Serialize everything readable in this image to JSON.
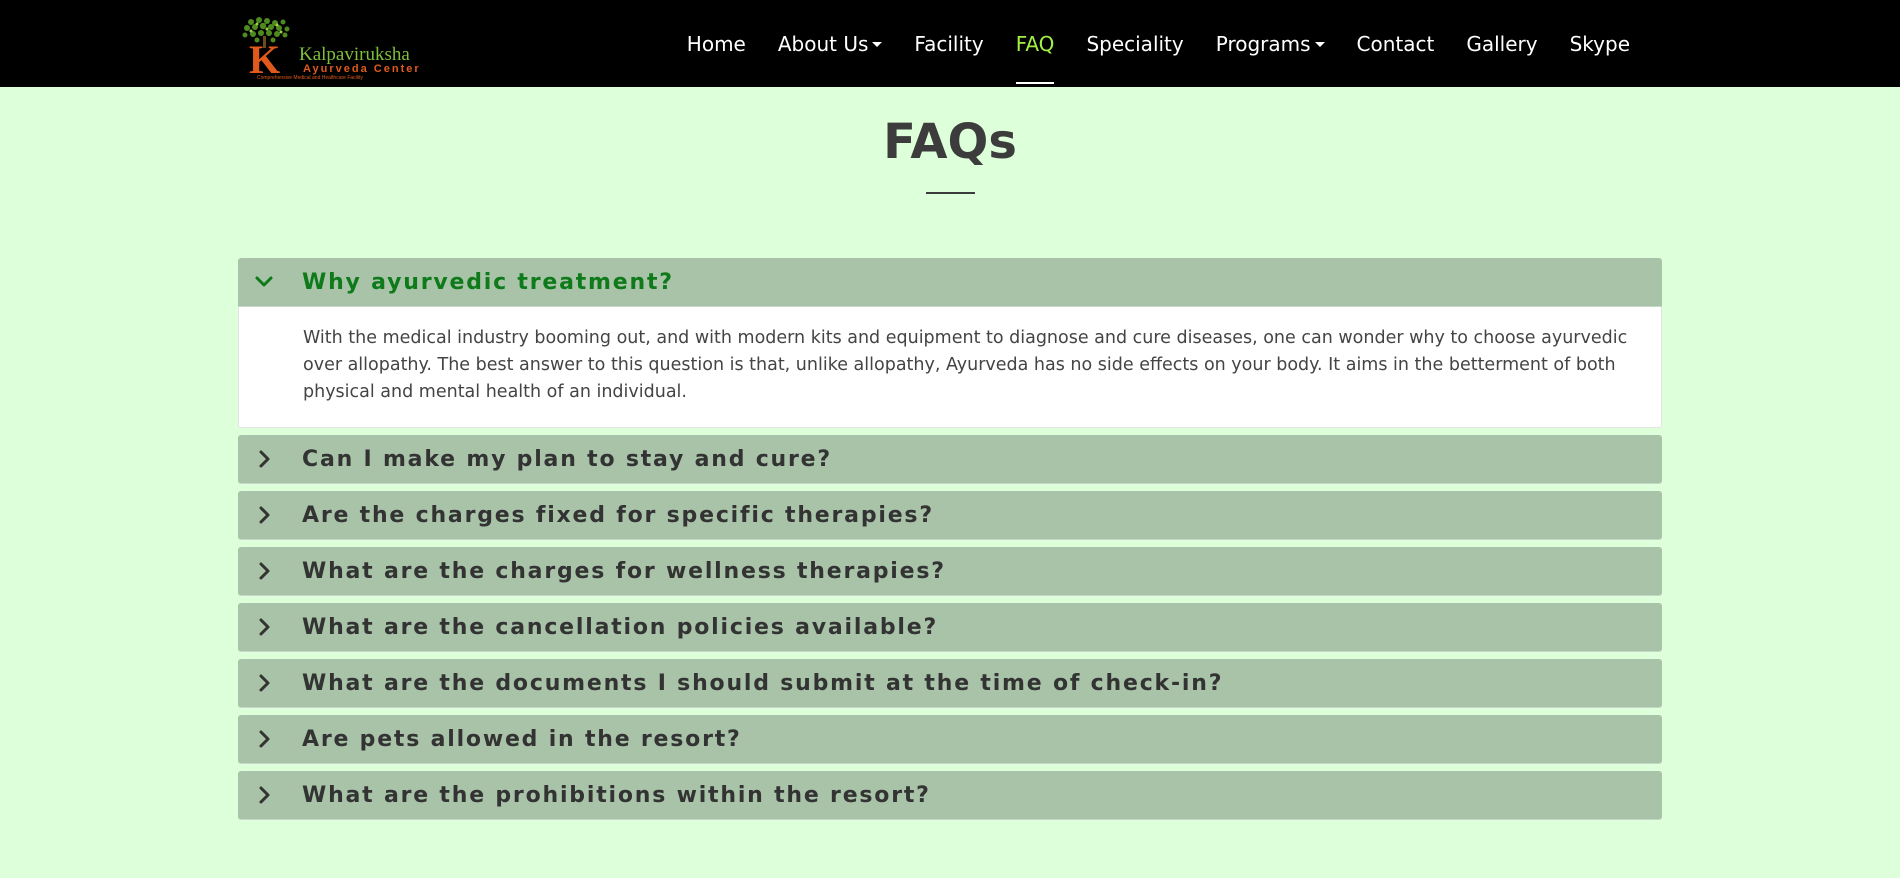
{
  "brand": {
    "logo_letter": "K",
    "logo_name": "Kalpaviruksha",
    "logo_sub": "Ayurveda Center",
    "logo_tagline": "Comprehensive Medical and Healthcare Facility"
  },
  "nav": {
    "items": [
      {
        "label": "Home",
        "dropdown": false,
        "active": false
      },
      {
        "label": "About Us",
        "dropdown": true,
        "active": false
      },
      {
        "label": "Facility",
        "dropdown": false,
        "active": false
      },
      {
        "label": "FAQ",
        "dropdown": false,
        "active": true
      },
      {
        "label": "Speciality",
        "dropdown": false,
        "active": false
      },
      {
        "label": "Programs",
        "dropdown": true,
        "active": false
      },
      {
        "label": "Contact",
        "dropdown": false,
        "active": false
      },
      {
        "label": "Gallery",
        "dropdown": false,
        "active": false
      },
      {
        "label": "Skype",
        "dropdown": false,
        "active": false
      }
    ],
    "active_color": "#a2f045"
  },
  "page": {
    "title": "FAQs"
  },
  "faq": {
    "items": [
      {
        "question": "Why ayurvedic treatment?",
        "open": true,
        "answer": "With the medical industry booming out, and with modern kits and equipment to diagnose and cure diseases, one can wonder why to choose ayurvedic over allopathy. The best answer to this question is that, unlike allopathy, Ayurveda has no side effects on your body. It aims in the betterment of both physical and mental health of an individual."
      },
      {
        "question": "Can I make my plan to stay and cure?",
        "open": false
      },
      {
        "question": "Are the charges fixed for specific therapies?",
        "open": false
      },
      {
        "question": "What are the charges for wellness therapies?",
        "open": false
      },
      {
        "question": "What are the cancellation policies available?",
        "open": false
      },
      {
        "question": "What are the documents I should submit at the time of check-in?",
        "open": false
      },
      {
        "question": "Are pets allowed in the resort?",
        "open": false
      },
      {
        "question": "What are the prohibitions within the resort?",
        "open": false
      }
    ]
  },
  "colors": {
    "page_bg": "#ddffd9",
    "navbar_bg": "#000000",
    "panel_heading_bg": "#a8c3a8",
    "open_question": "#0e7a1a",
    "title": "#3c3c3c"
  }
}
